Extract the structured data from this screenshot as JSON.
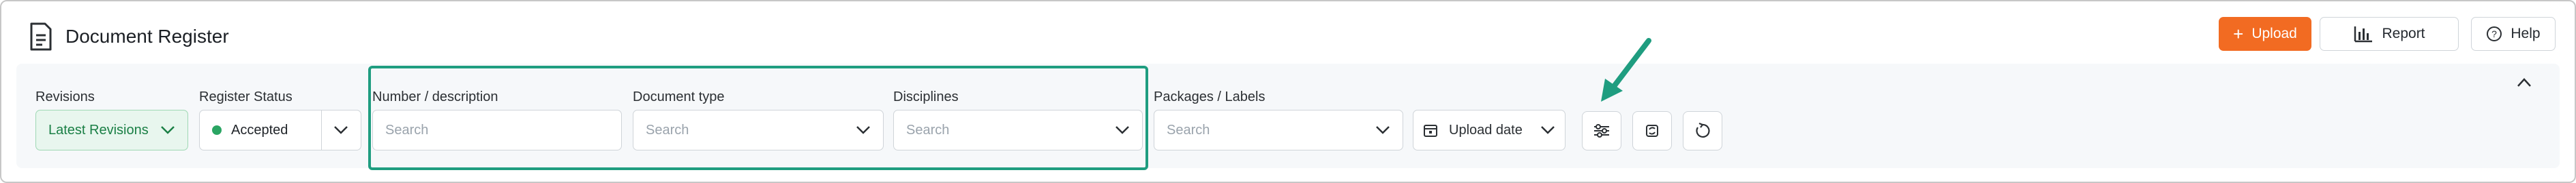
{
  "header": {
    "title": "Document Register",
    "upload_label": "Upload",
    "report_label": "Report",
    "help_label": "Help"
  },
  "filters": {
    "revisions": {
      "label": "Revisions",
      "value": "Latest Revisions"
    },
    "register_status": {
      "label": "Register Status",
      "value": "Accepted"
    },
    "number_description": {
      "label": "Number / description",
      "placeholder": "Search"
    },
    "document_type": {
      "label": "Document type",
      "placeholder": "Search"
    },
    "disciplines": {
      "label": "Disciplines",
      "placeholder": "Search"
    },
    "packages_labels": {
      "label": "Packages / Labels",
      "placeholder": "Search"
    },
    "sort": {
      "value": "Upload date"
    }
  },
  "icons": {
    "document": "document-icon",
    "plus": "plus-icon",
    "report": "bar-chart-icon",
    "help": "help-circle-icon",
    "collapse": "chevron-up-icon",
    "sort": "calendar-icon",
    "settings": "sliders-icon",
    "sync": "sync-icon",
    "reset": "reset-icon",
    "annotation": "arrow-annotation"
  },
  "colors": {
    "accent": "#f26b22",
    "highlight": "#1f9d80",
    "status_dot": "#2aa563",
    "revisions_bg": "#e8f6ee"
  }
}
